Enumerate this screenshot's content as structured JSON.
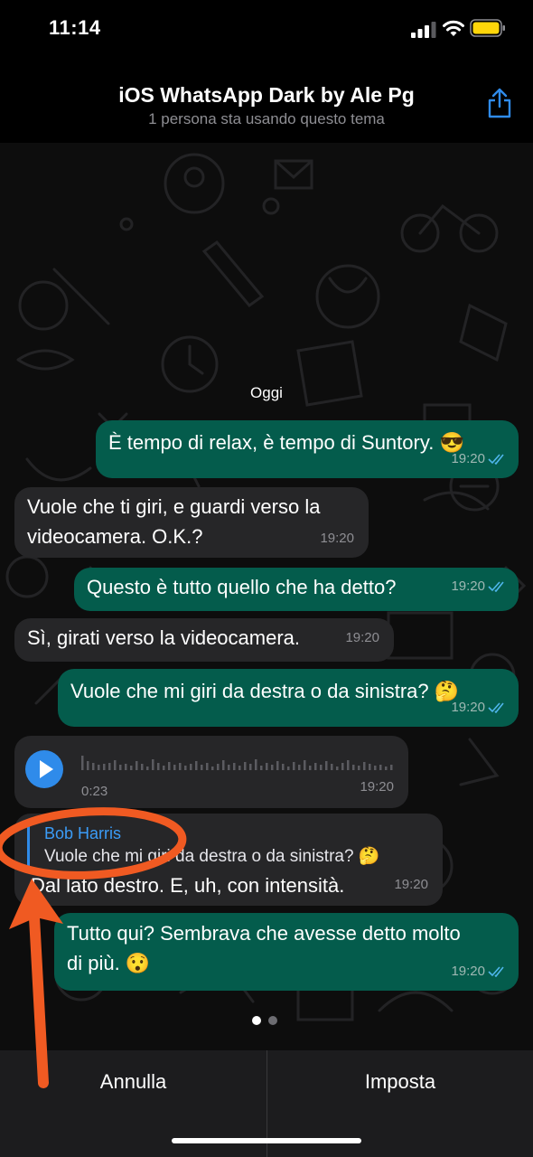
{
  "status": {
    "time": "11:14"
  },
  "header": {
    "title": "iOS WhatsApp Dark by Ale Pg",
    "subtitle": "1 persona sta usando questo tema"
  },
  "chat": {
    "date_label": "Oggi",
    "messages": [
      {
        "text": "È tempo di relax, è tempo di Suntory. 😎",
        "time": "19:20"
      },
      {
        "text": "Vuole che ti giri, e guardi verso la\nvideocamera. O.K.?",
        "time": "19:20"
      },
      {
        "text": "Questo è tutto quello che ha detto?",
        "time": "19:20"
      },
      {
        "text": "Sì, girati verso la videocamera.",
        "time": "19:20"
      },
      {
        "text": "Vuole che mi giri da destra o da sinistra? 🤔",
        "time": "19:20"
      },
      {
        "voice_duration": "0:23",
        "time": "19:20"
      },
      {
        "quote_author": "Bob Harris",
        "quote_text": "Vuole che mi giri da destra o da sinistra? 🤔",
        "text": "Dal lato destro. E, uh, con intensità.",
        "time": "19:20"
      },
      {
        "text": "Tutto qui? Sembrava che avesse detto molto\ndi più. 😯",
        "time": "19:20"
      }
    ]
  },
  "bottom": {
    "cancel_label": "Annulla",
    "set_label": "Imposta"
  },
  "colors": {
    "outgoing": "#045c4c",
    "incoming": "#262628",
    "accent": "#2f8bea",
    "annotation": "#f05a22"
  },
  "icons": [
    "share-icon",
    "signal-icon",
    "wifi-icon",
    "battery-icon",
    "double-check-icon",
    "play-icon"
  ]
}
